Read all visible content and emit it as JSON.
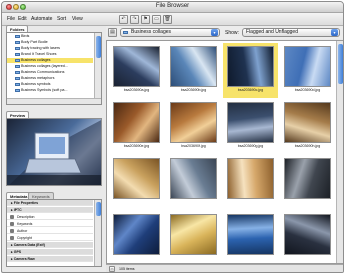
{
  "window": {
    "title": "File Browser"
  },
  "menu": [
    "File",
    "Edit",
    "Automate",
    "Sort",
    "View"
  ],
  "toolbar_icons": [
    "rotate-left-icon",
    "rotate-right-icon",
    "flag-icon",
    "new-folder-icon",
    "trash-icon"
  ],
  "panels": {
    "folders_tab": "Folders",
    "preview_tab": "Preview",
    "metadata_tab": "Metadata",
    "keywords_tab": "Keywords"
  },
  "folders": [
    {
      "label": "Birds",
      "selected": false
    },
    {
      "label": "Body Part Bodie",
      "selected": false
    },
    {
      "label": "Body tracing with lasers",
      "selected": false
    },
    {
      "label": "Brand It Travel Shoes",
      "selected": false
    },
    {
      "label": "Business collages",
      "selected": true
    },
    {
      "label": "Business collages (layered...",
      "selected": false
    },
    {
      "label": "Business Communications",
      "selected": false
    },
    {
      "label": "Business metaphors",
      "selected": false
    },
    {
      "label": "Business symbols",
      "selected": false
    },
    {
      "label": "Business Symbols (soft pa...",
      "selected": false
    }
  ],
  "metadata": [
    {
      "label": "File Properties",
      "head": true
    },
    {
      "label": "IPTC",
      "head": true
    },
    {
      "label": "Description",
      "head": false
    },
    {
      "label": "Keywords",
      "head": false
    },
    {
      "label": "Author",
      "head": false
    },
    {
      "label": "Copyright",
      "head": false
    },
    {
      "label": "Camera Data (Exif)",
      "head": true
    },
    {
      "label": "GPS",
      "head": true
    },
    {
      "label": "Camera Raw",
      "head": true
    }
  ],
  "location": {
    "folder": "Business collages",
    "show_label": "Show:",
    "filter": "Flagged and Unflagged"
  },
  "thumbnails": [
    {
      "caption": "bsa203690a.jpg",
      "selected": false,
      "colors": [
        "#2c3d5e",
        "#9fb7d8",
        "#1a2231"
      ]
    },
    {
      "caption": "bsa203690b.jpg",
      "selected": false,
      "colors": [
        "#5a86b8",
        "#d9e6f2",
        "#2d4e78"
      ]
    },
    {
      "caption": "bsa203690c.jpg",
      "selected": true,
      "colors": [
        "#1f3250",
        "#7ea1cf",
        "#0f1a2c"
      ]
    },
    {
      "caption": "bsa203690d.jpg",
      "selected": false,
      "colors": [
        "#3f6fb6",
        "#c9dbf3",
        "#5d88c4"
      ]
    },
    {
      "caption": "bsa203690e.jpg",
      "selected": false,
      "colors": [
        "#9a5a2a",
        "#e2b680",
        "#4a2812"
      ]
    },
    {
      "caption": "bsa203690f.jpg",
      "selected": false,
      "colors": [
        "#b87a3e",
        "#f1cf98",
        "#6b3a17"
      ]
    },
    {
      "caption": "bsa203690g.jpg",
      "selected": false,
      "colors": [
        "#3b4f6e",
        "#a8b8d2",
        "#232f42"
      ]
    },
    {
      "caption": "bsa203690h.jpg",
      "selected": false,
      "colors": [
        "#a57c4a",
        "#e7d0a8",
        "#55391d"
      ]
    },
    {
      "caption": "",
      "selected": false,
      "colors": [
        "#c9a15e",
        "#f3dcb0",
        "#7a5424"
      ]
    },
    {
      "caption": "",
      "selected": false,
      "colors": [
        "#6a7d93",
        "#c3ccd8",
        "#3b4655"
      ]
    },
    {
      "caption": "",
      "selected": false,
      "colors": [
        "#d6a86b",
        "#f6e2bf",
        "#8c5f2c"
      ]
    },
    {
      "caption": "",
      "selected": false,
      "colors": [
        "#40464f",
        "#9aa1ab",
        "#1c2026"
      ]
    },
    {
      "caption": "",
      "selected": false,
      "colors": [
        "#1f3e7a",
        "#5f86c8",
        "#0e1d3c"
      ]
    },
    {
      "caption": "",
      "selected": false,
      "colors": [
        "#d9b45a",
        "#f8e6a5",
        "#8b6a22"
      ]
    },
    {
      "caption": "",
      "selected": false,
      "colors": [
        "#2c63b0",
        "#86b1e6",
        "#153563"
      ]
    },
    {
      "caption": "",
      "selected": false,
      "colors": [
        "#2a3140",
        "#8b97ab",
        "#12161f"
      ]
    }
  ],
  "status": {
    "count": "105 items"
  }
}
